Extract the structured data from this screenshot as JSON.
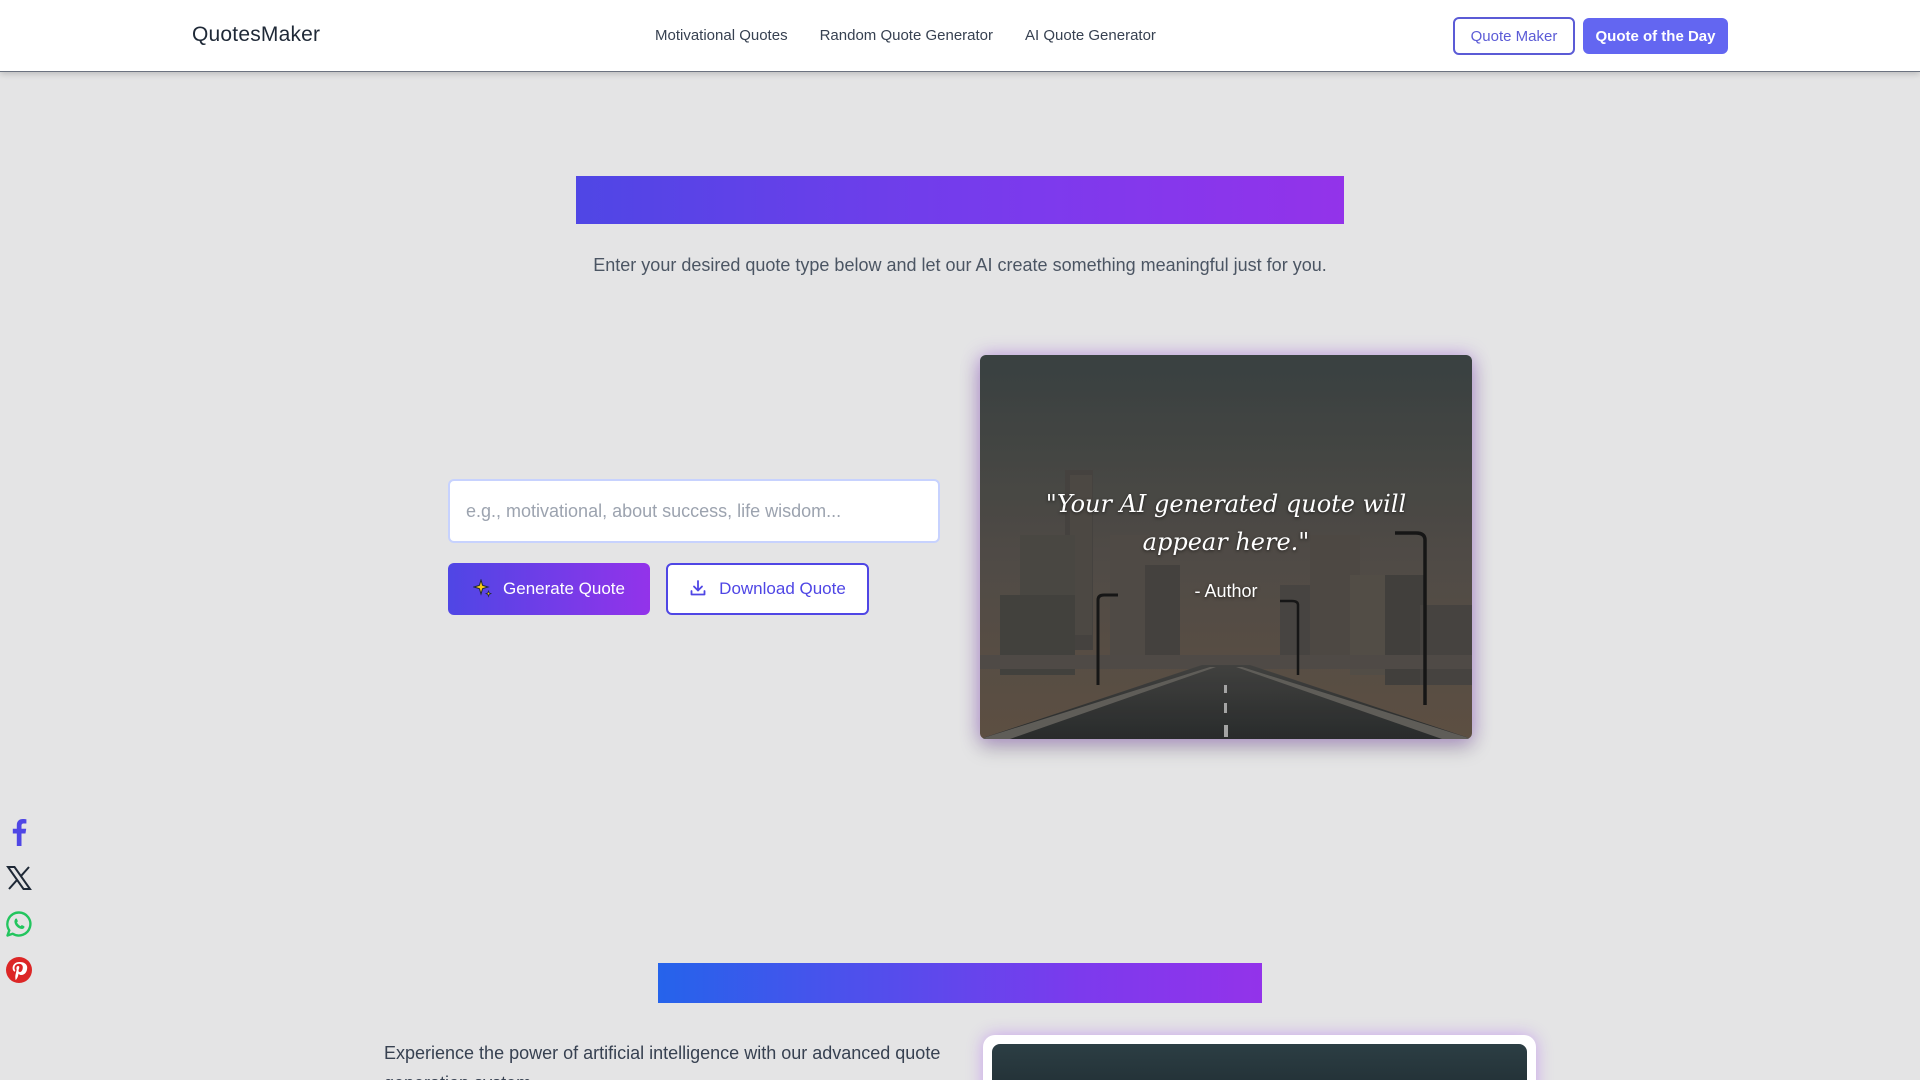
{
  "brand": "QuotesMaker",
  "nav": {
    "links": [
      "Motivational Quotes",
      "Random Quote Generator",
      "AI Quote Generator"
    ],
    "quote_maker": "Quote Maker",
    "quote_of_day": "Quote of the Day"
  },
  "hero": {
    "subtitle": "Enter your desired quote type below and let our AI create something meaningful just for you."
  },
  "generator": {
    "placeholder": "e.g., motivational, about success, life wisdom...",
    "generate_label": "Generate Quote",
    "download_label": "Download Quote"
  },
  "quote_card": {
    "quote": "\"Your AI generated quote will appear here.\"",
    "author": "- Author"
  },
  "social": [
    "facebook-icon",
    "x-icon",
    "whatsapp-icon",
    "pinterest-icon"
  ],
  "section2": {
    "text": "Experience the power of artificial intelligence with our advanced quote generation system."
  },
  "colors": {
    "accent": "#6366f1",
    "gradient_start": "#4f46e5",
    "gradient_end": "#9333ea",
    "background": "#e4e4e5"
  }
}
